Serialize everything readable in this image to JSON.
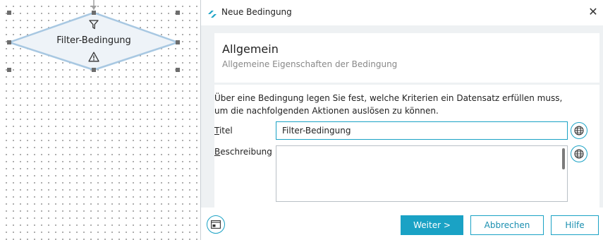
{
  "canvas": {
    "node": {
      "label": "Filter-Bedingung",
      "icons": [
        "filter-icon",
        "warning-icon"
      ]
    }
  },
  "dialog": {
    "title": "Neue Bedingung",
    "close_symbol": "✕",
    "header": {
      "title": "Allgemein",
      "subtitle": "Allgemeine Eigenschaften der Bedingung"
    },
    "intro_line1": "Über eine Bedingung legen Sie fest, welche Kriterien ein Datensatz erfüllen muss,",
    "intro_line2": "um die nachfolgenden Aktionen auslösen zu können.",
    "fields": {
      "title": {
        "label_first": "T",
        "label_rest": "itel",
        "value": "Filter-Bedingung"
      },
      "description": {
        "label_first": "B",
        "label_rest": "eschreibung",
        "value": ""
      }
    },
    "footer": {
      "next_label": "Weiter >",
      "cancel_label": "Abbrechen",
      "help_label": "Hilfe"
    }
  },
  "colors": {
    "accent": "#1aa2c5",
    "node_fill": "#eef3f8",
    "node_stroke": "#a8c8e2",
    "content_bg": "#eef1f3"
  }
}
